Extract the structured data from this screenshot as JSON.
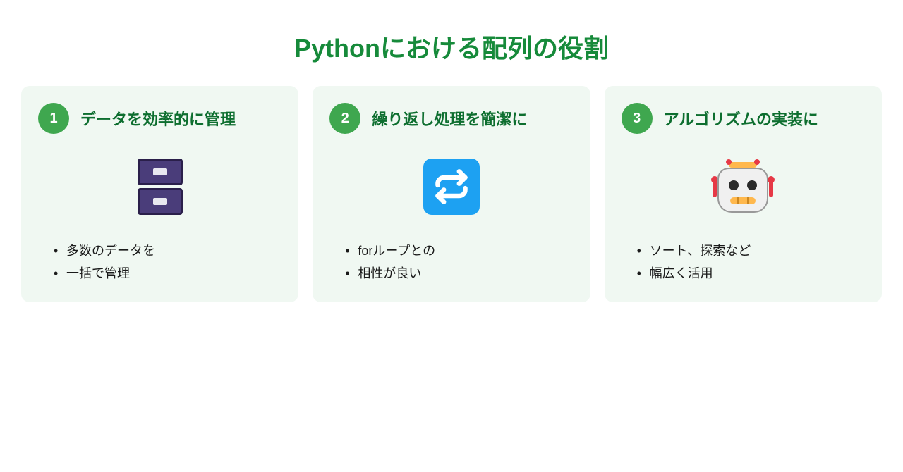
{
  "title": "Pythonにおける配列の役割",
  "cards": [
    {
      "number": "1",
      "title": "データを効率的に管理",
      "icon": "cabinet",
      "bullets": [
        "多数のデータを",
        "一括で管理"
      ]
    },
    {
      "number": "2",
      "title": "繰り返し処理を簡潔に",
      "icon": "loop",
      "bullets": [
        "forループとの",
        "相性が良い"
      ]
    },
    {
      "number": "3",
      "title": "アルゴリズムの実装に",
      "icon": "robot",
      "bullets": [
        "ソート、探索など",
        "幅広く活用"
      ]
    }
  ]
}
